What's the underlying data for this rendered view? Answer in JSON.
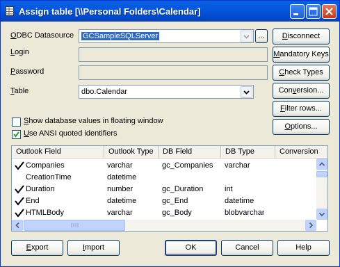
{
  "window": {
    "title": "Assign table [\\\\Personal Folders\\Calendar]"
  },
  "form": {
    "odbc_label_u": "O",
    "odbc_label_rest": "DBC Datasource",
    "odbc_value": "GCSampleSQLServer",
    "browse_label": "...",
    "login_label_u": "L",
    "login_label_rest": "ogin",
    "password_label_u": "P",
    "password_label_rest": "assword",
    "table_label_u": "T",
    "table_label_rest": "able",
    "table_value": "dbo.Calendar",
    "show_db_values_u": "S",
    "show_db_values_rest": "how database values in floating window",
    "show_db_values_checked": false,
    "ansi_u": "U",
    "ansi_rest": "se ANSI quoted identifiers",
    "ansi_checked": true
  },
  "side_buttons": {
    "disconnect_u": "D",
    "disconnect_rest": "isconnect",
    "mandatory_u": "M",
    "mandatory_rest": "andatory Keys",
    "check_u": "C",
    "check_rest": "heck Types",
    "conversion_pre": "Con",
    "conversion_u": "v",
    "conversion_rest": "ersion...",
    "filter_u": "F",
    "filter_rest": "ilter rows...",
    "options_u": "O",
    "options_rest": "ptions..."
  },
  "grid": {
    "columns": [
      "Outlook Field",
      "Outlook Type",
      "DB Field",
      "DB Type",
      "Conversion"
    ],
    "rows": [
      {
        "checked": true,
        "outlook_field": "Companies",
        "outlook_type": "varchar",
        "db_field": "gc_Companies",
        "db_type": "varchar"
      },
      {
        "checked": false,
        "outlook_field": "CreationTime",
        "outlook_type": "datetime",
        "db_field": "",
        "db_type": ""
      },
      {
        "checked": true,
        "outlook_field": "Duration",
        "outlook_type": "number",
        "db_field": "gc_Duration",
        "db_type": "int"
      },
      {
        "checked": true,
        "outlook_field": "End",
        "outlook_type": "datetime",
        "db_field": "gc_End",
        "db_type": "datetime"
      },
      {
        "checked": true,
        "outlook_field": "HTMLBody",
        "outlook_type": "varchar",
        "db_field": "gc_Body",
        "db_type": "blobvarchar"
      }
    ]
  },
  "footer": {
    "export_u": "E",
    "export_rest": "xport",
    "import_u": "I",
    "import_rest": "mport",
    "ok_label": "OK",
    "cancel_label": "Cancel",
    "help_label": "Help"
  },
  "colors": {
    "titlebar": "#0358e0",
    "face": "#ece9d8",
    "selection": "#316ac5"
  }
}
